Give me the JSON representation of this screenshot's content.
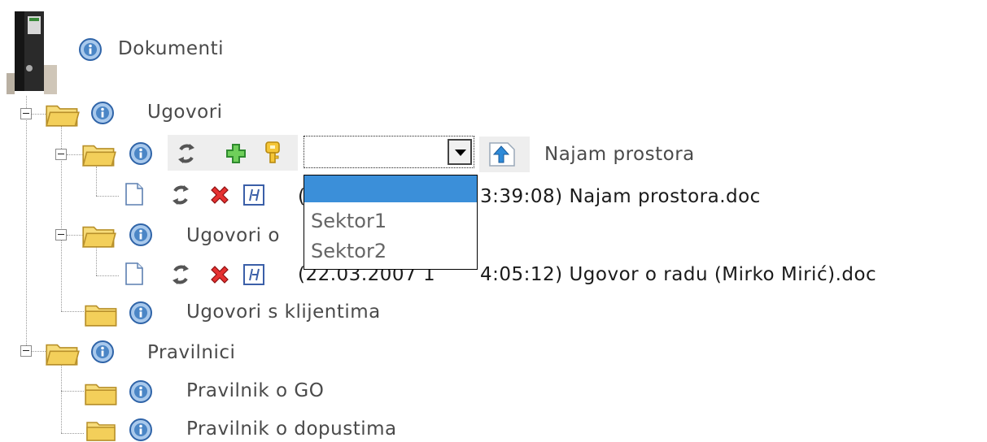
{
  "tree": {
    "root": {
      "label": "Dokumenti",
      "icon": "binder-image"
    },
    "ugovori": {
      "label": "Ugovori"
    },
    "najam_prostora": {
      "label": "Najam prostora",
      "combo": {
        "value": "",
        "options": [
          "",
          "Sektor1",
          "Sektor2"
        ]
      }
    },
    "najam_doc": {
      "label_visible": "3:39:08) Najam prostora.doc",
      "timestamp_visible": "("
    },
    "ugovori_o": {
      "label_visible": "Ugovori o"
    },
    "ugovor_doc": {
      "timestamp_visible": "(22.03.2007 1",
      "label_visible": "4:05:12) Ugovor o radu (Mirko Mirić).doc"
    },
    "ugovori_klijenti": {
      "label": "Ugovori s klijentima"
    },
    "pravilnici": {
      "label": "Pravilnici"
    },
    "pravilnik_go": {
      "label": "Pravilnik o GO"
    },
    "pravilnik_dopust": {
      "label": "Pravilnik o dopustima"
    }
  },
  "icons": {
    "info": "info-icon",
    "folder": "folder-icon",
    "refresh": "refresh-icon",
    "add": "add-icon",
    "key": "key-icon",
    "delete": "delete-icon",
    "history": "history-icon",
    "document": "document-icon",
    "upload": "upload-icon"
  },
  "colors": {
    "folder": "#f3cf5a",
    "info_blue": "#4b86c6",
    "selection": "#3b8fd9",
    "add_green": "#3aa23a",
    "delete_red": "#d8232a",
    "key_gold": "#f0b323"
  }
}
